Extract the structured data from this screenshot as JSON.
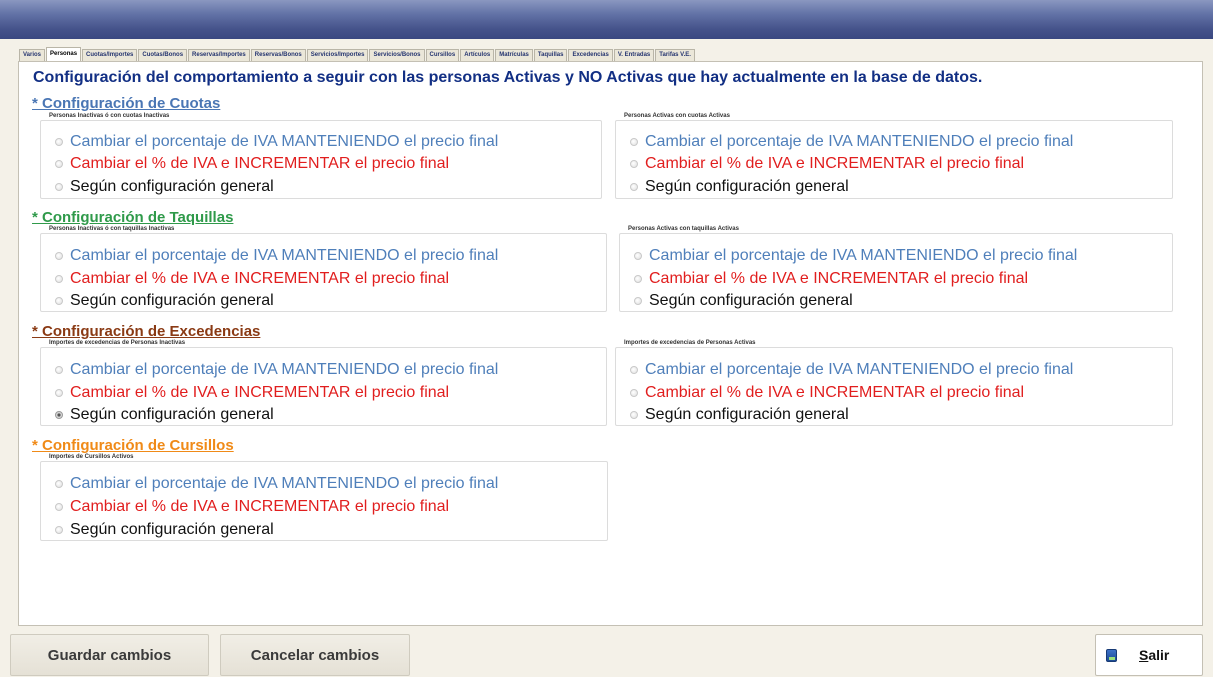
{
  "tabs": [
    "Varios",
    "Personas",
    "Cuotas/Importes",
    "Cuotas/Bonos",
    "Reservas/Importes",
    "Reservas/Bonos",
    "Servicios/Importes",
    "Servicios/Bonos",
    "Cursillos",
    "Artículos",
    "Matrículas",
    "Taquillas",
    "Excedencias",
    "V. Entradas",
    "Tarifas V.E."
  ],
  "active_tab": "Personas",
  "headline": "Configuración del comportamiento a seguir con las personas Activas y NO Activas que hay actualmente en la base de datos.",
  "option_labels": {
    "keep": "Cambiar el porcentaje de IVA MANTENIENDO el precio final",
    "increase": "Cambiar el % de IVA e INCREMENTAR el precio final",
    "general": "Según configuración general"
  },
  "colors": {
    "headline": "#122f84",
    "keep": "#4f7fba",
    "increase": "#e11e1e",
    "general": "#111111",
    "cuotas": "#4a76b4",
    "taquillas": "#2f9a4a",
    "excedencias": "#8a3a14",
    "cursillos": "#f08a17"
  },
  "sections": {
    "cuotas": {
      "title": "* Configuración de Cuotas",
      "left_caption": "Personas Inactivas ó con cuotas Inactivas",
      "right_caption": "Personas Activas con cuotas Activas",
      "left_selected": "none",
      "right_selected": "none"
    },
    "taquillas": {
      "title": "* Configuración de Taquillas",
      "left_caption": "Personas Inactivas ó con taquillas Inactivas",
      "right_caption": "Personas Activas con taquillas Activas",
      "left_selected": "none",
      "right_selected": "none"
    },
    "excedencias": {
      "title": "* Configuración de Excedencias",
      "left_caption": "Importes de excedencias de Personas Inactivas",
      "right_caption": "Importes de excedencias de Personas Activas",
      "left_selected": "general",
      "right_selected": "none"
    },
    "cursillos": {
      "title": "* Configuración de Cursillos",
      "caption": "Importes de Cursillos Activos",
      "selected": "none"
    }
  },
  "buttons": {
    "save": "Guardar cambios",
    "cancel": "Cancelar cambios",
    "exit": "Salir"
  }
}
